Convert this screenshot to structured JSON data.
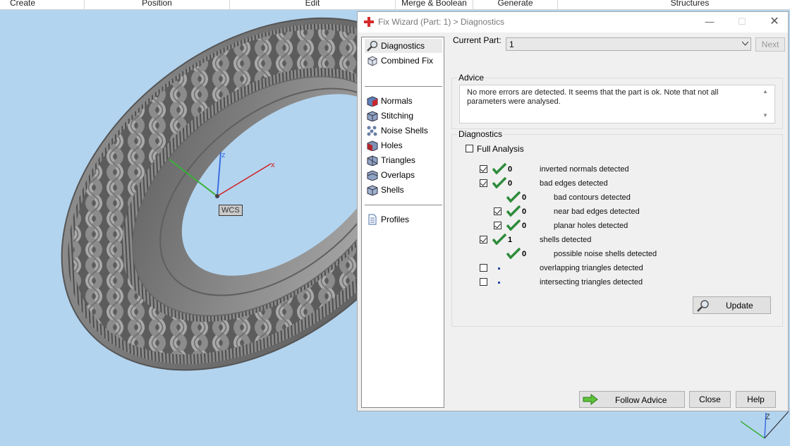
{
  "menubar": {
    "items": [
      "Create",
      "Position",
      "Edit",
      "Merge & Boolean",
      "Generate",
      "Structures"
    ]
  },
  "viewport": {
    "wcs_label": "WCS",
    "axis_x": "x",
    "axis_z": "z"
  },
  "dialog": {
    "title": "Fix Wizard (Part: 1) > Diagnostics",
    "nav": {
      "top": [
        "Diagnostics",
        "Combined Fix"
      ],
      "middle": [
        "Normals",
        "Stitching",
        "Noise Shells",
        "Holes",
        "Triangles",
        "Overlaps",
        "Shells"
      ],
      "bottom": [
        "Profiles"
      ]
    },
    "current_part_label": "Current Part:",
    "current_part_value": "1",
    "next_button": "Next",
    "advice_title": "Advice",
    "advice_text": "No more errors are detected. It seems that the part is ok. Note that not all parameters were analysed.",
    "diagnostics_title": "Diagnostics",
    "full_analysis_label": "Full Analysis",
    "rows": [
      {
        "value": "0",
        "label": "inverted normals detected"
      },
      {
        "value": "0",
        "label": "bad edges detected"
      },
      {
        "value": "0",
        "label": "bad contours detected"
      },
      {
        "value": "0",
        "label": "near bad edges detected"
      },
      {
        "value": "0",
        "label": "planar holes detected"
      },
      {
        "value": "1",
        "label": "shells detected"
      },
      {
        "value": "0",
        "label": "possible noise shells detected"
      },
      {
        "value": "",
        "label": "overlapping triangles detected"
      },
      {
        "value": "",
        "label": "intersecting triangles detected"
      }
    ],
    "update_button": "Update",
    "follow_advice_button": "Follow Advice",
    "close_button": "Close",
    "help_button": "Help"
  },
  "corner_axis": {
    "z": "Z"
  },
  "colors": {
    "check_green": "#2e8b3a",
    "viewport_bg": "#b3d4ef",
    "dialog_bg": "#f0f0f0"
  }
}
